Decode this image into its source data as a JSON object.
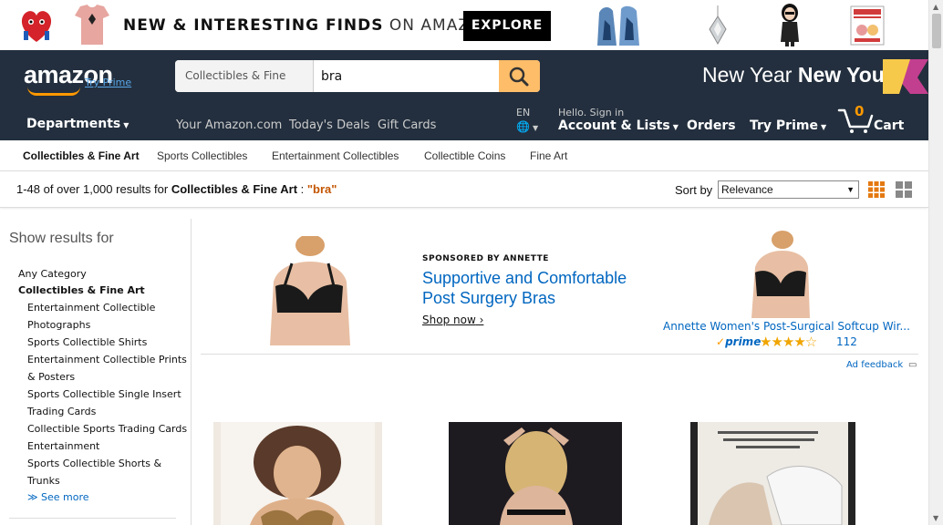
{
  "promo": {
    "text_bold": "NEW & INTERESTING FINDS",
    "text_thin": "ON AMAZON",
    "explore_label": "EXPLORE",
    "thumbnails": [
      "plush-heart-icon",
      "printed-tshirt-icon",
      "geode-bookends-icon",
      "pendant-icon",
      "figurine-icon",
      "card-icon"
    ]
  },
  "header": {
    "logo_text": "amazon",
    "try_prime_link": "Try Prime",
    "search_category": "Collectibles & Fine Art",
    "search_value": "bra",
    "new_year": "New Year",
    "new_you": "New You",
    "departments": "Departments",
    "links": [
      "Your Amazon.com",
      "Today's Deals",
      "Gift Cards"
    ],
    "language": "EN",
    "hello": "Hello. Sign in",
    "account": "Account & Lists",
    "orders": "Orders",
    "try_prime": "Try Prime",
    "cart_count": "0",
    "cart_label": "Cart"
  },
  "subnav": {
    "items": [
      "Collectibles & Fine Art",
      "Sports Collectibles",
      "Entertainment Collectibles",
      "Collectible Coins",
      "Fine Art"
    ]
  },
  "results": {
    "prefix": "1-48 of over 1,000 results for",
    "category": "Collectibles & Fine Art",
    "separator": " : ",
    "query": "\"bra\"",
    "sort_label": "Sort by",
    "sort_value": "Relevance"
  },
  "sidebar": {
    "title": "Show results for",
    "any_category": "Any Category",
    "current": "Collectibles & Fine Art",
    "items": [
      "Entertainment Collectible",
      "Photographs",
      "Sports Collectible Shirts",
      "Entertainment Collectible Prints",
      "& Posters",
      "Sports Collectible Single Insert",
      "Trading Cards",
      "Collectible Sports Trading Cards",
      "Entertainment",
      "Sports Collectible Shorts &",
      "Trunks"
    ],
    "see_more": "See more"
  },
  "ad": {
    "sponsored": "SPONSORED BY ANNETTE",
    "headline": "Supportive and Comfortable Post Surgery Bras",
    "shop_now": "Shop now",
    "product_title": "Annette Women's Post-Surgical Softcup Wir...",
    "prime": "prime",
    "rating_stars": 3.5,
    "rating_display": "★★★★☆",
    "review_count": "112",
    "feedback": "Ad feedback"
  },
  "colors": {
    "nav_bg": "#232f3e",
    "accent": "#febd69",
    "orange": "#ff9900",
    "link": "#0066c0"
  }
}
